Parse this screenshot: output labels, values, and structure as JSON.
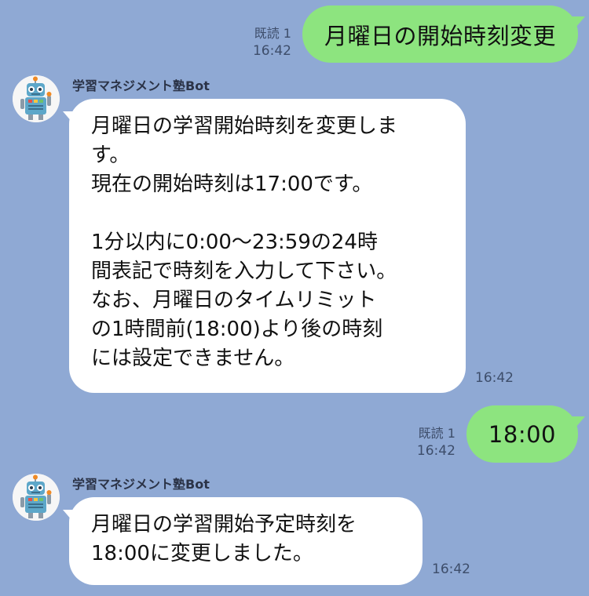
{
  "chat": {
    "bot_name": "学習マネジメント塾Bot",
    "messages": [
      {
        "direction": "out",
        "read_label": "既読 1",
        "time": "16:42",
        "text": "月曜日の開始時刻変更"
      },
      {
        "direction": "in",
        "sender": "学習マネジメント塾Bot",
        "time": "16:42",
        "lines": [
          "月曜日の学習開始時刻を変更しま",
          "す。",
          "現在の開始時刻は17:00です。",
          "",
          "1分以内に0:00〜23:59の24時",
          "間表記で時刻を入力して下さい。",
          "なお、月曜日のタイムリミット",
          "の1時間前(18:00)より後の時刻",
          "には設定できません。"
        ]
      },
      {
        "direction": "out",
        "read_label": "既読 1",
        "time": "16:42",
        "text": "18:00"
      },
      {
        "direction": "in",
        "sender": "学習マネジメント塾Bot",
        "time": "16:42",
        "lines": [
          "月曜日の学習開始予定時刻を",
          "18:00に変更しました。"
        ]
      }
    ]
  },
  "colors": {
    "background": "#8fa9d4",
    "outgoing_bubble": "#8de47f",
    "incoming_bubble": "#ffffff",
    "meta_text": "#3d4d6a"
  },
  "icons": {
    "avatar": "robot-avatar-icon"
  }
}
